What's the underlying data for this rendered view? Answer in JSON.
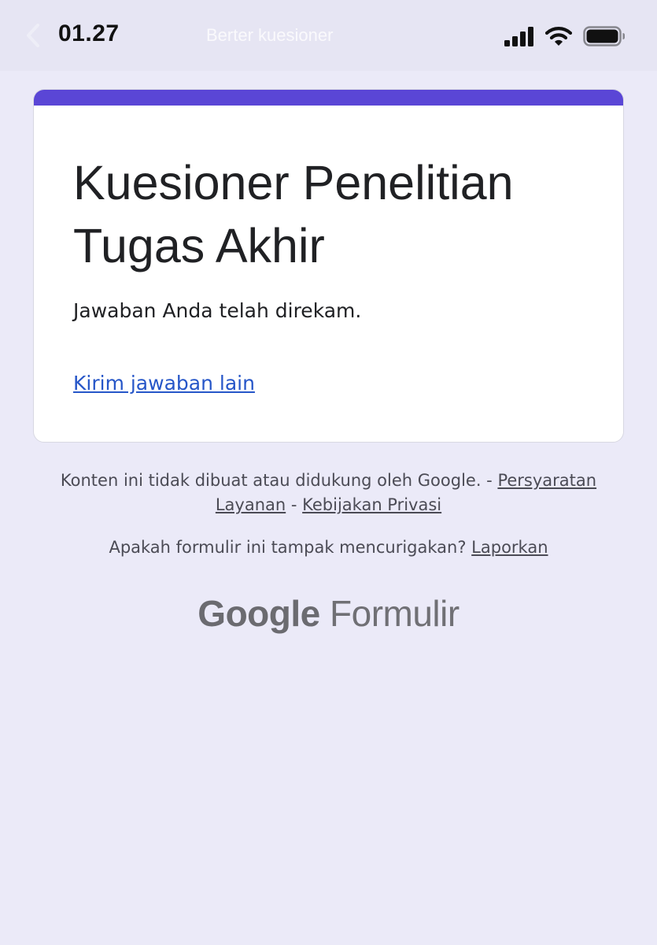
{
  "status_bar": {
    "time": "01.27",
    "ghost_title": "Berter kuesioner",
    "icons": [
      "back-chevron-icon",
      "cellular-signal-icon",
      "wifi-icon",
      "battery-icon"
    ]
  },
  "card": {
    "accent_color": "#5a46d6",
    "title": "Kuesioner Penelitian Tugas Akhir",
    "message": "Jawaban Anda telah direkam.",
    "submit_another_label": "Kirim jawaban lain"
  },
  "footer": {
    "disclaimer_text": "Konten ini tidak dibuat atau didukung oleh Google. - ",
    "terms_label": "Persyaratan Layanan",
    "separator": " - ",
    "privacy_label": "Kebijakan Privasi",
    "report_question": "Apakah formulir ini tampak mencurigakan? ",
    "report_label": "Laporkan"
  },
  "brand": {
    "google": "Google",
    "product": "Formulir"
  }
}
